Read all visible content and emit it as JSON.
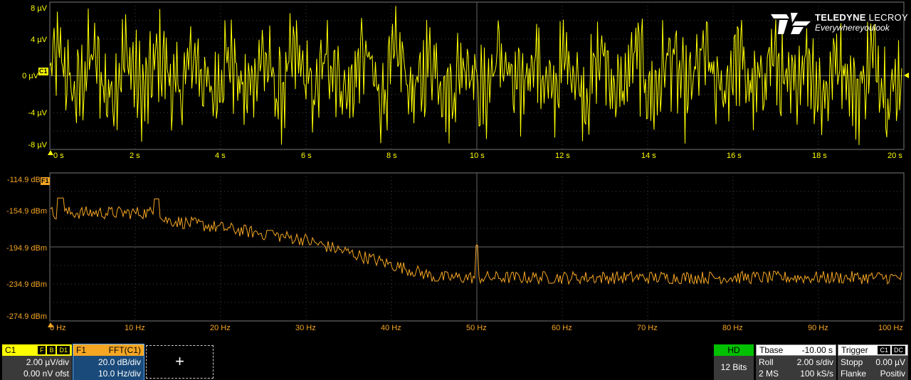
{
  "brand": {
    "name": "TELEDYNE",
    "name2": "LECROY",
    "tagline": "Everywhereyoulook"
  },
  "colors": {
    "channel": "#ffff00",
    "math": "#f5a623",
    "grid": "#5a5a5a",
    "panel": "#3a3a3a",
    "hd": "#00c000"
  },
  "time_grid": {
    "y_labels": [
      "8 µV",
      "4 µV",
      "0 µV",
      "-4 µV",
      "-8 µV"
    ],
    "x_labels": [
      "0 s",
      "2 s",
      "4 s",
      "6 s",
      "8 s",
      "10 s",
      "12 s",
      "14 s",
      "16 s",
      "18 s",
      "20 s"
    ],
    "marker": "C1"
  },
  "fft_grid": {
    "y_labels": [
      "-114.9 dBm",
      "-154.9 dBm",
      "-194.9 dBm",
      "-234.9 dBm",
      "-274.9 dBm"
    ],
    "x_labels": [
      "0 Hz",
      "10 Hz",
      "20 Hz",
      "30 Hz",
      "40 Hz",
      "50 Hz",
      "60 Hz",
      "70 Hz",
      "80 Hz",
      "90 Hz",
      "100 Hz"
    ],
    "marker": "F1"
  },
  "c1": {
    "name": "C1",
    "badges": [
      "F",
      "B",
      "D1"
    ],
    "vdiv": "2.00 µV/div",
    "offset": "0.00 nV ofst"
  },
  "f1": {
    "name": "F1",
    "func": "FFT(C1)",
    "vdiv": "20.0 dB/div",
    "hdiv": "10.0 Hz/div"
  },
  "add_math": "+",
  "hd": {
    "label": "HD",
    "bits": "12 Bits"
  },
  "timebase": {
    "label": "Tbase",
    "delay": "-10.00 s",
    "mode": "Roll",
    "tdiv": "2.00 s/div",
    "points": "2 MS",
    "rate": "100 kS/s"
  },
  "trigger": {
    "label": "Trigger",
    "src": "C1",
    "coupling": "DC",
    "state": "Stopp",
    "level": "0.00 µV",
    "type": "Flanke",
    "slope": "Positiv"
  }
}
